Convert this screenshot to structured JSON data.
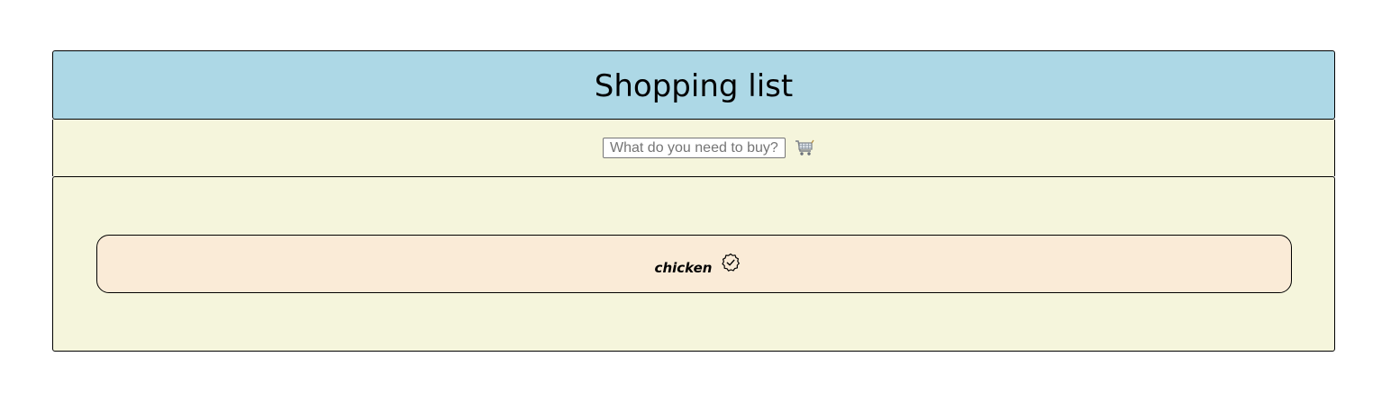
{
  "header": {
    "title": "Shopping list",
    "background": "#add8e6"
  },
  "entry": {
    "placeholder": "What do you need to buy?",
    "value": "",
    "submit_icon": "shopping-cart-icon"
  },
  "list": {
    "background": "#f5f5dc",
    "items": [
      {
        "label": "chicken",
        "action_icon": "check-badge-icon",
        "background": "#faebd7"
      }
    ]
  }
}
